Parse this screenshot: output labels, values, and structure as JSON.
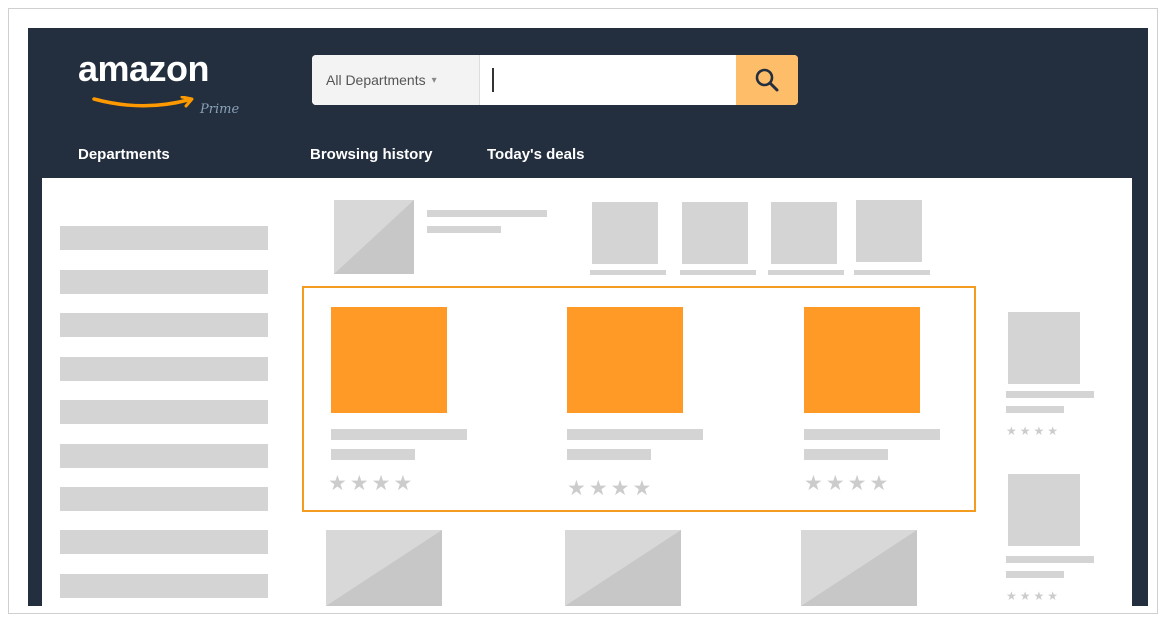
{
  "brand": {
    "name": "amazon",
    "subtitle": "Prime"
  },
  "search": {
    "department_label": "All Departments",
    "query": "",
    "placeholder": ""
  },
  "nav": {
    "departments": "Departments",
    "browsing_history": "Browsing history",
    "todays_deals": "Today's deals"
  },
  "colors": {
    "header_bg": "#232f3e",
    "search_button": "#febd69",
    "highlight_border": "#f39c1f",
    "featured_image": "#ff9a27",
    "placeholder_gray": "#d4d4d4"
  },
  "featured_products": [
    {
      "rating": 4,
      "stars": "★★★★"
    },
    {
      "rating": 4,
      "stars": "★★★★"
    },
    {
      "rating": 4,
      "stars": "★★★★"
    }
  ],
  "side_products": [
    {
      "rating": 4,
      "stars": "★★★★"
    },
    {
      "rating": 4,
      "stars": "★★★★"
    }
  ],
  "icons": {
    "search": "magnifier-icon",
    "dropdown": "chevron-down-icon",
    "logo_smile": "smile-arrow-icon"
  }
}
